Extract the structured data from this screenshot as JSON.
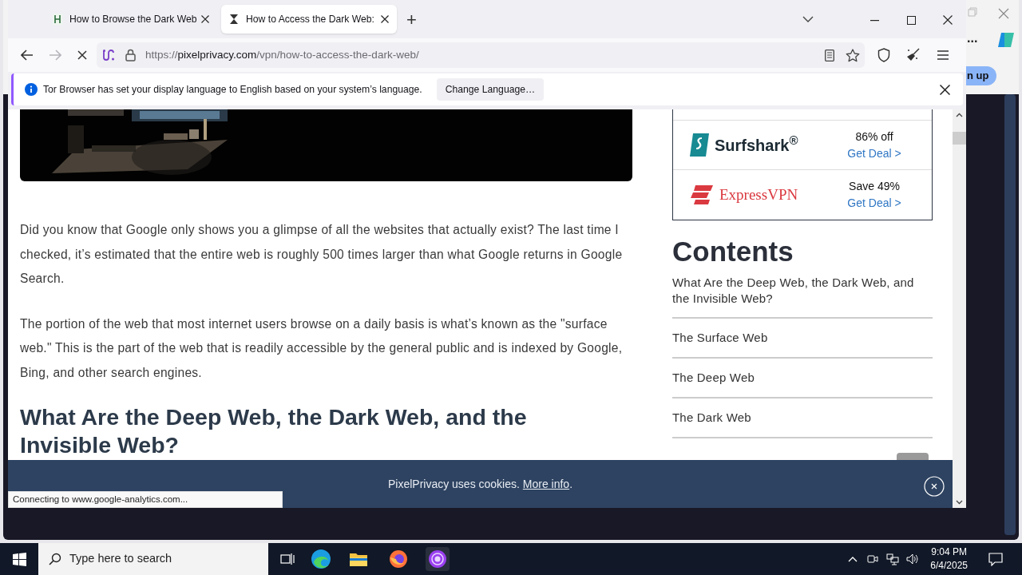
{
  "background_window": {
    "more_button": "...",
    "signup_button": "n up"
  },
  "browser": {
    "tabs": [
      {
        "title": "How to Browse the Dark Web",
        "selected": false,
        "kind": "site"
      },
      {
        "title": "How to Access the Dark Web:",
        "selected": true,
        "kind": "loading"
      }
    ],
    "new_tab": "+",
    "nav": {
      "forward_disabled": true
    },
    "address": {
      "scheme": "https://",
      "domain": "pixelprivacy.com",
      "path": "/vpn/how-to-access-the-dark-web/"
    },
    "notification": {
      "message": "Tor Browser has set your display language to English based on your system’s language.",
      "button": "Change Language…"
    },
    "status": "Connecting to www.google-analytics.com..."
  },
  "page": {
    "paragraphs": [
      "Did you know that Google only shows you a glimpse of all the websites that actually exist? The last time I checked, it’s estimated that the entire web is roughly 500 times larger than what Google returns in Google Search.",
      "The portion of the web that most internet users browse on a daily basis is what’s known as the \"surface web.\" This is the part of the web that is readily accessible by the general public and is indexed by Google, Bing, and other search engines."
    ],
    "heading": "What Are the Deep Web, the Dark Web, and the Invisible Web?",
    "deals": [
      {
        "kind": "shark",
        "brand": "Surfshark$^{®}$",
        "offer": "86% off",
        "link": "Get Deal >"
      },
      {
        "kind": "express",
        "brand": "ExpressVPN",
        "offer": "Save 49%",
        "link": "Get Deal >"
      }
    ],
    "contents": {
      "title": "Contents",
      "items": [
        "What Are the Deep Web, the Dark Web, and the Invisible Web?",
        "The Surface Web",
        "The Deep Web",
        "The Dark Web"
      ]
    },
    "cookie": {
      "text": "PixelPrivacy uses cookies.",
      "link": "More info",
      "end": "."
    }
  },
  "taskbar": {
    "search_placeholder": "Type here to search",
    "time": "9:04 PM",
    "date": "6/4/2025"
  }
}
